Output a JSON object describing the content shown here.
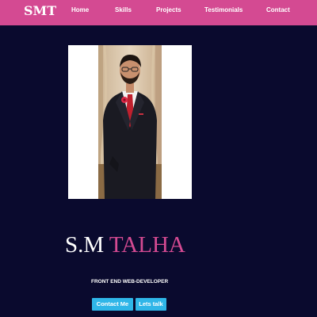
{
  "nav": {
    "logo": "SMT",
    "links": [
      "Home",
      "Skills",
      "Projects",
      "Testimonials",
      "Contact"
    ]
  },
  "hero": {
    "name_first": "S.M",
    "name_last": "TALHA",
    "role": "FRONT END WEB-DEVELOPER",
    "buttons": [
      "Contact Me",
      "Lets talk"
    ]
  },
  "colors": {
    "navbar": "#d44a92",
    "background": "#0a0a2e",
    "accent": "#d44a92",
    "button": "#2fb6e8"
  }
}
